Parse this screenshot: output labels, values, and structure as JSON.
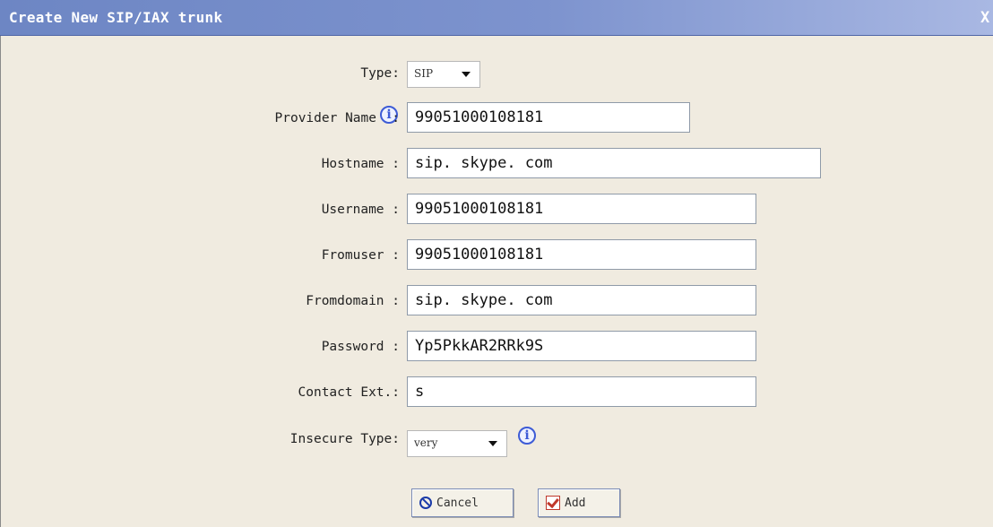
{
  "dialog": {
    "title": "Create New SIP/IAX trunk",
    "close_label": "X"
  },
  "form": {
    "type": {
      "label": "Type:",
      "value": "SIP"
    },
    "provider_name": {
      "label": "Provider Name",
      "suffix": ":",
      "value": "99051000108181"
    },
    "hostname": {
      "label": "Hostname :",
      "value": "sip. skype. com"
    },
    "username": {
      "label": "Username :",
      "value": "99051000108181"
    },
    "fromuser": {
      "label": "Fromuser :",
      "value": "99051000108181"
    },
    "fromdomain": {
      "label": "Fromdomain :",
      "value": "sip. skype. com"
    },
    "password": {
      "label": "Password :",
      "value": "Yp5PkkAR2RRk9S"
    },
    "contact_ext": {
      "label": "Contact Ext.:",
      "value": "s"
    },
    "insecure_type": {
      "label": "Insecure Type:",
      "value": "very"
    }
  },
  "buttons": {
    "cancel_label": "Cancel",
    "add_label": "Add"
  },
  "icons": {
    "info": "info-icon",
    "dropdown": "chevron-down-icon",
    "cancel": "cancel-icon",
    "add": "checkbox-check-icon"
  },
  "colors": {
    "titlebar": "#7d93ce",
    "background": "#f0ebe0",
    "info_icon": "#3d5bd6"
  }
}
